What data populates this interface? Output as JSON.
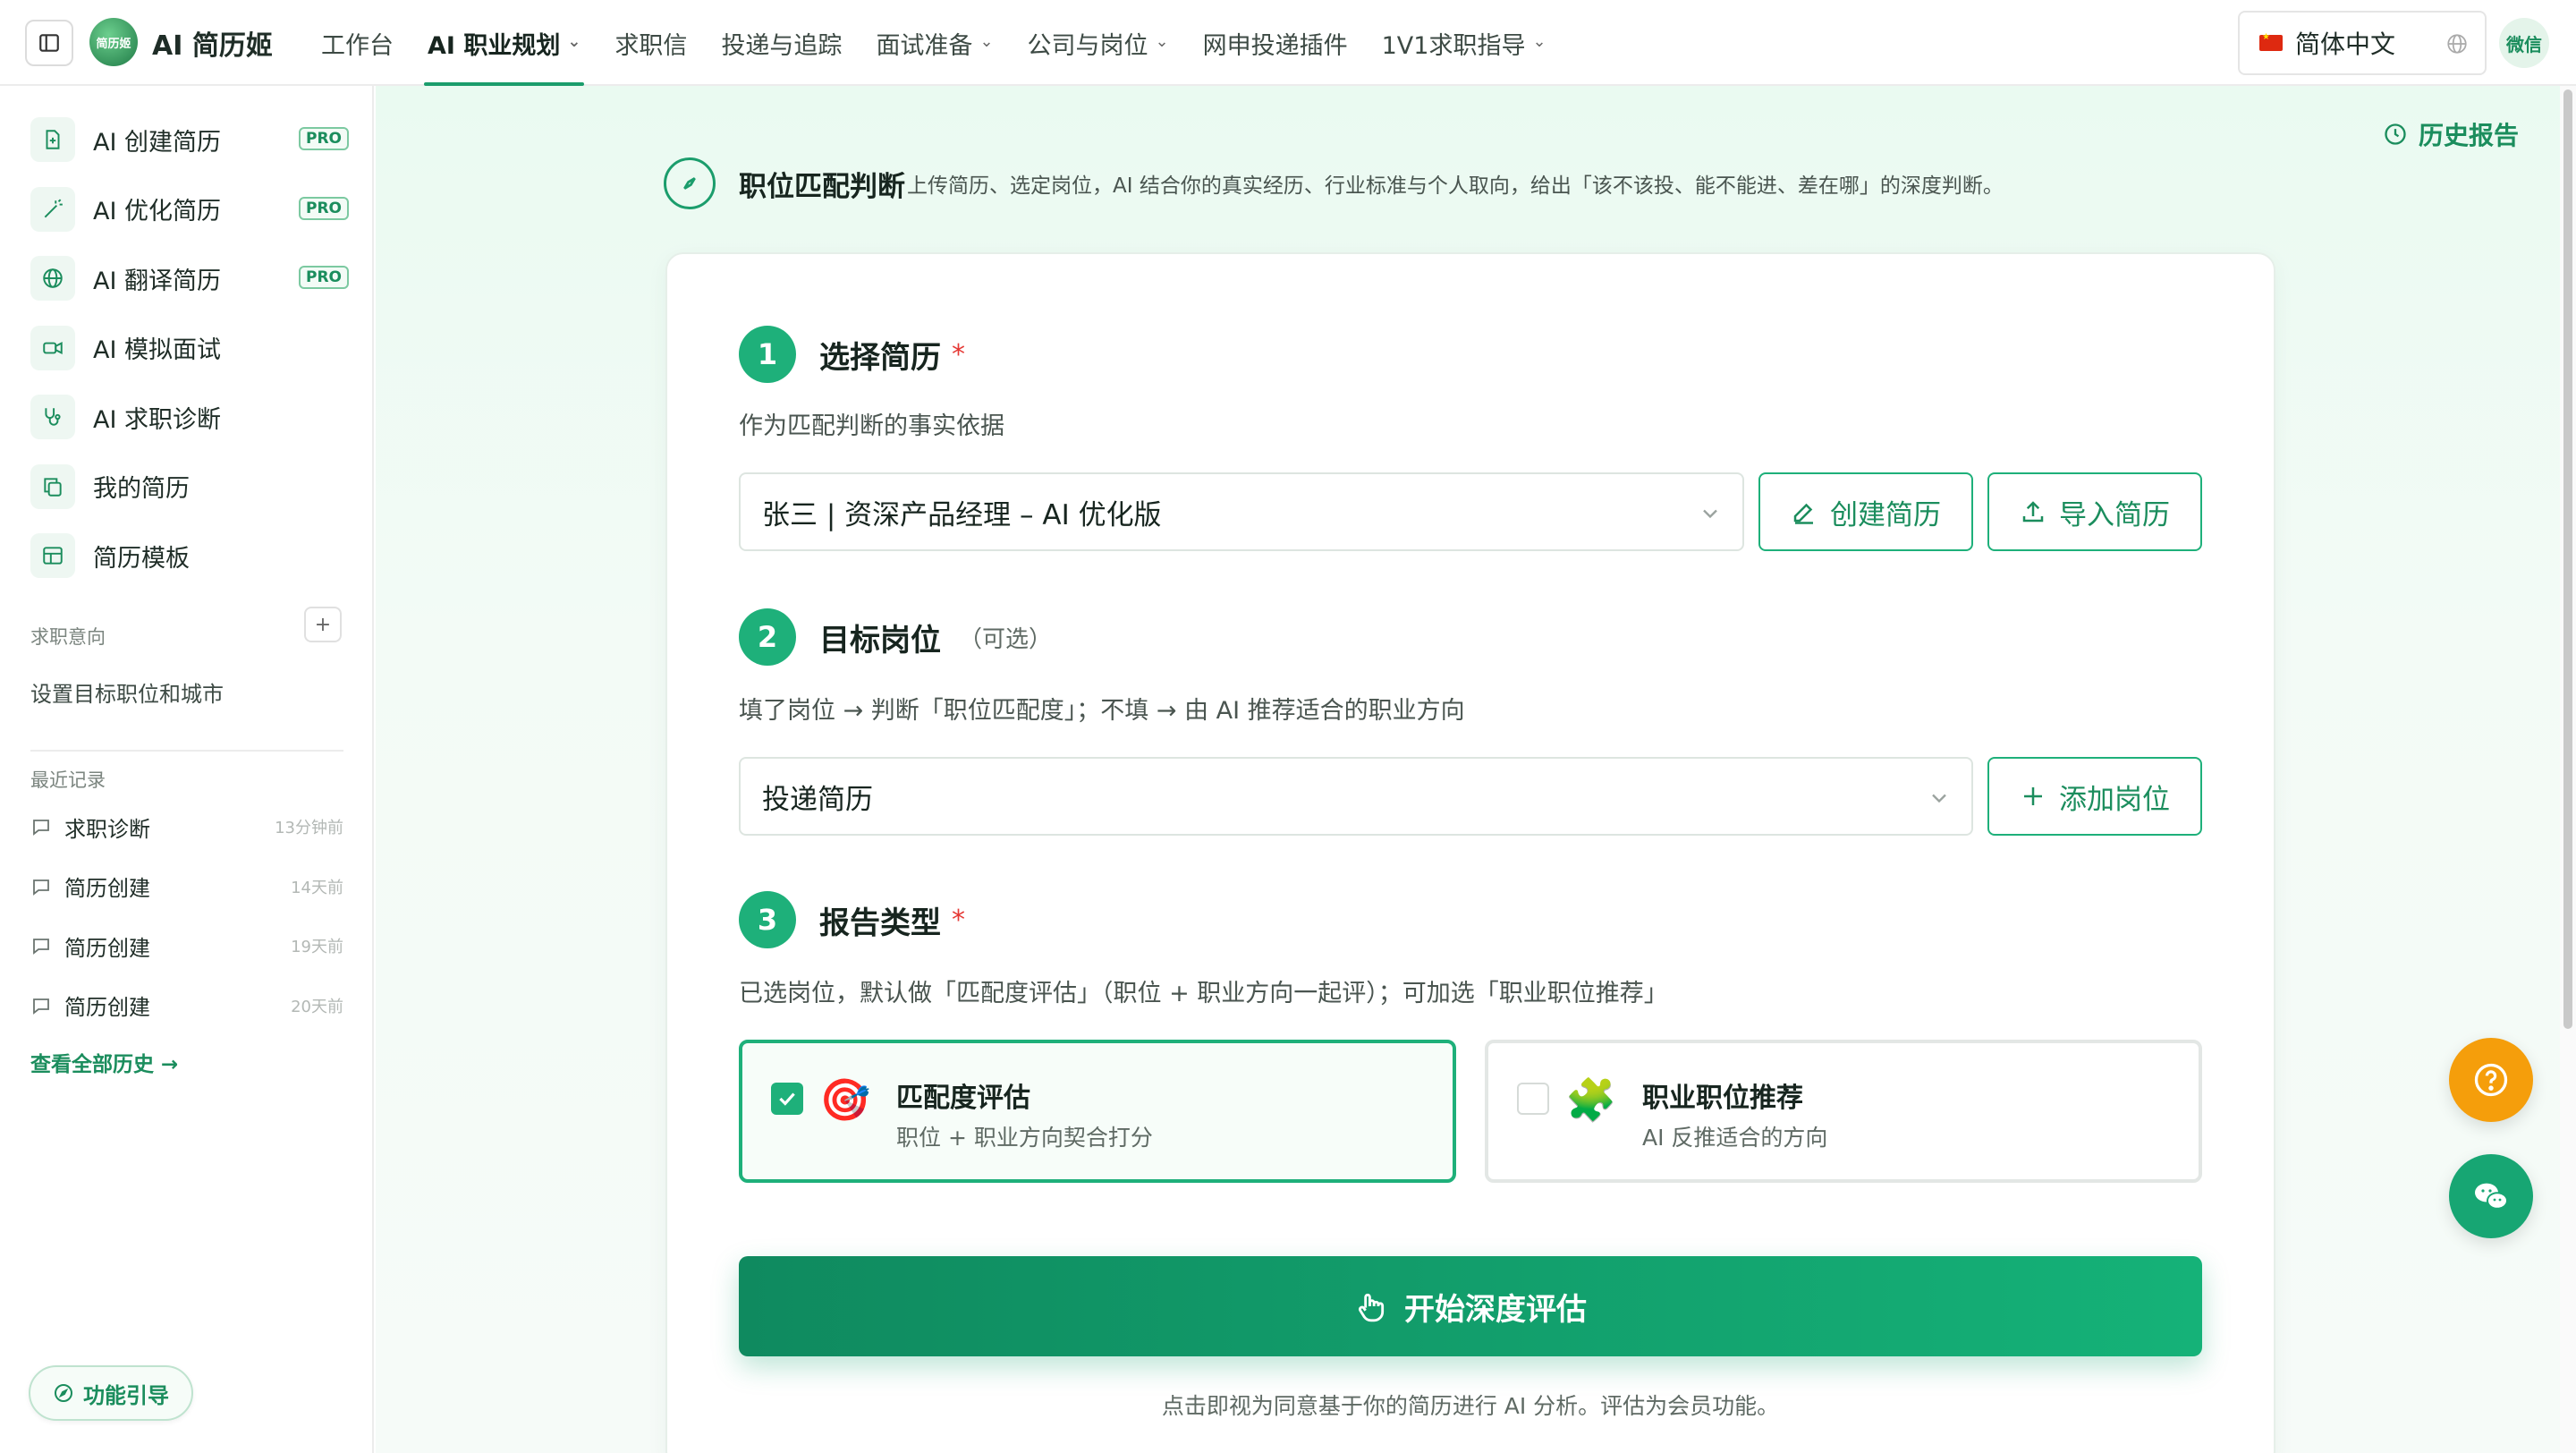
{
  "header": {
    "brand": "AI 简历姬",
    "logo_text": "简历姬",
    "nav": [
      {
        "label": "工作台",
        "active": false,
        "dropdown": false
      },
      {
        "label": "AI 职业规划",
        "active": true,
        "dropdown": true
      },
      {
        "label": "求职信",
        "active": false,
        "dropdown": false
      },
      {
        "label": "投递与追踪",
        "active": false,
        "dropdown": false
      },
      {
        "label": "面试准备",
        "active": false,
        "dropdown": true
      },
      {
        "label": "公司与岗位",
        "active": false,
        "dropdown": true
      },
      {
        "label": "网申投递插件",
        "active": false,
        "dropdown": false
      },
      {
        "label": "1V1求职指导",
        "active": false,
        "dropdown": true
      }
    ],
    "language": "简体中文",
    "wechat_label": "微信"
  },
  "sidebar": {
    "items": [
      {
        "label": "AI 创建简历",
        "pro": "PRO",
        "icon": "file-plus-icon"
      },
      {
        "label": "AI 优化简历",
        "pro": "PRO",
        "icon": "magic-wand-icon"
      },
      {
        "label": "AI 翻译简历",
        "pro": "PRO",
        "icon": "globe-icon"
      },
      {
        "label": "AI 模拟面试",
        "pro": "",
        "icon": "video-icon"
      },
      {
        "label": "AI 求职诊断",
        "pro": "",
        "icon": "stethoscope-icon"
      },
      {
        "label": "我的简历",
        "pro": "",
        "icon": "copy-icon"
      },
      {
        "label": "简历模板",
        "pro": "",
        "icon": "layout-icon"
      }
    ],
    "intent_title": "求职意向",
    "intent_setting": "设置目标职位和城市",
    "recent_title": "最近记录",
    "recent": [
      {
        "label": "求职诊断",
        "time": "13分钟前"
      },
      {
        "label": "简历创建",
        "time": "14天前"
      },
      {
        "label": "简历创建",
        "time": "19天前"
      },
      {
        "label": "简历创建",
        "time": "20天前"
      }
    ],
    "view_all": "查看全部历史 →",
    "guide": "功能引导"
  },
  "main": {
    "history_link": "历史报告",
    "title": "职位匹配判断",
    "description": "上传简历、选定岗位，AI 结合你的真实经历、行业标准与个人取向，给出「该不该投、能不能进、差在哪」的深度判断。",
    "step1": {
      "num": "1",
      "title": "选择简历",
      "required": "*",
      "desc": "作为匹配判断的事实依据",
      "selected_resume": "张三 | 资深产品经理 – AI 优化版",
      "create_btn": "创建简历",
      "import_btn": "导入简历"
    },
    "step2": {
      "num": "2",
      "title": "目标岗位",
      "optional": "（可选）",
      "desc": "填了岗位 → 判断「职位匹配度」；不填 → 由 AI 推荐适合的职业方向",
      "selected_job": "投递简历",
      "add_btn": "添加岗位"
    },
    "step3": {
      "num": "3",
      "title": "报告类型",
      "required": "*",
      "desc": "已选岗位，默认做「匹配度评估」（职位 + 职业方向一起评）；可加选「职业职位推荐」",
      "options": [
        {
          "title": "匹配度评估",
          "sub": "职位 + 职业方向契合打分",
          "emoji": "🎯",
          "checked": true
        },
        {
          "title": "职业职位推荐",
          "sub": "AI 反推适合的方向",
          "emoji": "🧩",
          "checked": false
        }
      ]
    },
    "cta": "开始深度评估",
    "footnote": "点击即视为同意基于你的简历进行 AI 分析。评估为会员功能。"
  },
  "colors": {
    "accent": "#1eb07a",
    "accent_dark": "#1b8d5d",
    "help_fab": "#f59e0b",
    "required": "#e53935"
  }
}
